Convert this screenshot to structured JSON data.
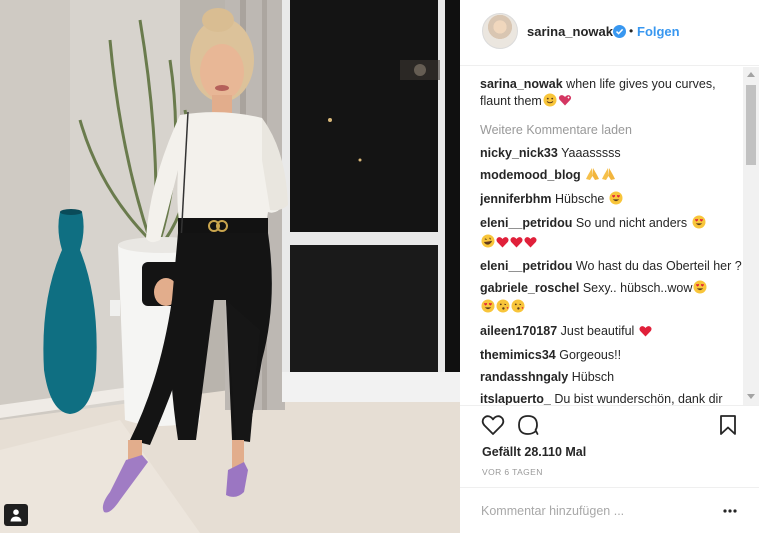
{
  "post": {
    "username": "sarina_nowak",
    "follow_label": "Folgen",
    "dot": "•",
    "caption": {
      "user": "sarina_nowak",
      "text": "when life gives you curves, flaunt them"
    },
    "load_more": "Weitere Kommentare laden",
    "comments": [
      {
        "user": "nicky_nick33",
        "text": "Yaaasssss"
      },
      {
        "user": "modemood_blog",
        "text": ""
      },
      {
        "user": "jenniferbhm",
        "text": "Hübsche"
      },
      {
        "user": "eleni__petridou",
        "text": "So und nicht anders"
      },
      {
        "user": "eleni__petridou",
        "text": "Wo hast du das Oberteil her ?"
      },
      {
        "user": "gabriele_roschel",
        "text": "Sexy.. hübsch..wow"
      },
      {
        "user": "aileen170187",
        "text": "Just beautiful"
      },
      {
        "user": "themimics34",
        "text": "Gorgeous!!"
      },
      {
        "user": "randasshngaly",
        "text": "Hübsch"
      },
      {
        "user": "itslapuerto_",
        "text": "Du bist wunderschön, dank dir fühle ich mich in meiner Haut ein"
      }
    ],
    "likes_text": "Gefällt 28.110 Mal",
    "timestamp": "VOR 6 TAGEN",
    "add_comment_placeholder": "Kommentar hinzufügen ...",
    "icons": {
      "verified": "verified-badge-icon",
      "like": "heart-outline-icon",
      "comment": "speech-bubble-icon",
      "save": "bookmark-icon",
      "more": "ellipsis-icon",
      "tag": "user-tag-icon"
    },
    "colors": {
      "link_blue": "#3897f0",
      "text": "#262626",
      "muted": "#999999",
      "heart_red": "#ed4956"
    }
  }
}
